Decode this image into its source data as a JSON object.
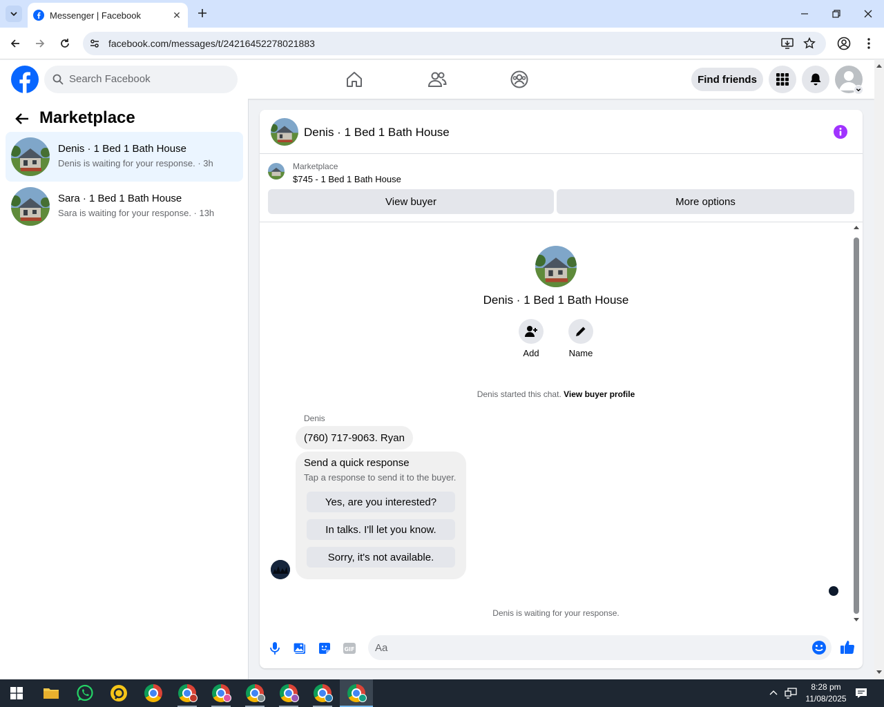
{
  "browser": {
    "tab_title": "Messenger | Facebook",
    "url": "facebook.com/messages/t/24216452278021883"
  },
  "fb": {
    "search_placeholder": "Search Facebook",
    "find_friends": "Find friends"
  },
  "sidebar": {
    "heading": "Marketplace",
    "conversations": [
      {
        "name": "Denis · 1 Bed 1 Bath House",
        "preview": "Denis is waiting for your response. · 3h"
      },
      {
        "name": "Sara · 1 Bed 1 Bath House",
        "preview": "Sara is waiting for your response. · 13h"
      }
    ]
  },
  "chat": {
    "title": "Denis · 1 Bed 1 Bath House",
    "listing_category": "Marketplace",
    "listing_price": "$745 - 1 Bed 1 Bath House",
    "view_buyer": "View buyer",
    "more_options": "More options",
    "center_title": "Denis · 1 Bed 1 Bath House",
    "add_label": "Add",
    "name_label": "Name",
    "started_text": "Denis started this chat.",
    "view_buyer_profile": "View buyer profile",
    "sender_name": "Denis",
    "message": "(760) 717-9063.  Ryan",
    "quick_title": "Send a quick response",
    "quick_subtitle": "Tap a response to send it to the buyer.",
    "quick_responses": [
      "Yes, are you interested?",
      "In talks. I'll let you know.",
      "Sorry, it's not available."
    ],
    "waiting_text": "Denis is waiting for your response.",
    "composer_placeholder": "Aa"
  },
  "taskbar": {
    "time": "8:28 pm",
    "date": "11/08/2025"
  },
  "colors": {
    "fb_blue": "#0866ff",
    "accent_purple": "#a033ff",
    "taskbar": "#1e2732"
  },
  "icons": [
    "facebook-logo-icon",
    "search-icon",
    "home-icon",
    "friends-icon",
    "groups-icon",
    "menu-grid-icon",
    "bell-icon",
    "avatar-icon",
    "back-arrow-icon",
    "info-icon",
    "add-person-icon",
    "pencil-icon",
    "microphone-icon",
    "gallery-icon",
    "sticker-icon",
    "gif-icon",
    "emoji-icon",
    "thumbs-up-icon"
  ]
}
